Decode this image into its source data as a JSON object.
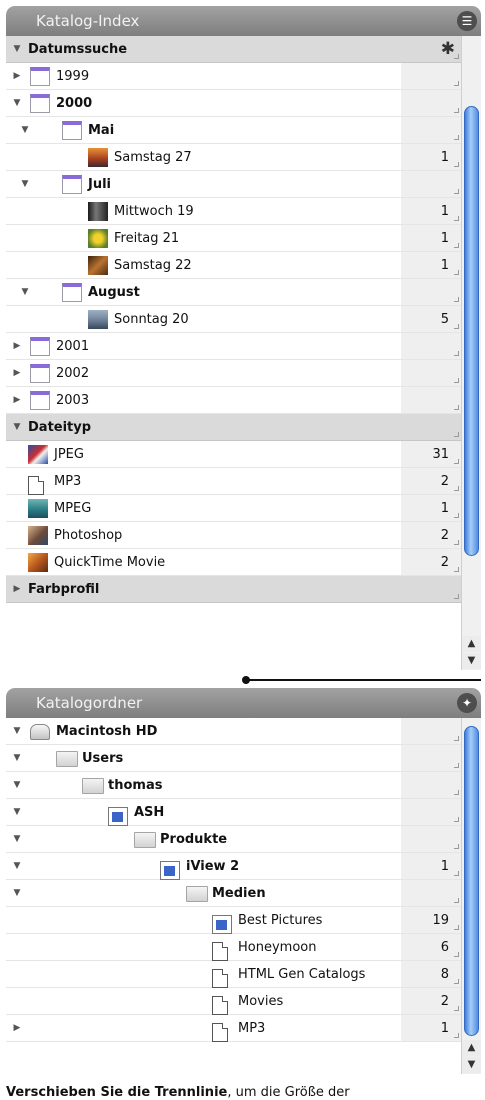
{
  "panel_top": {
    "title": "Katalog-Index",
    "title_button_icon": "list-icon",
    "rows": [
      {
        "kind": "header",
        "indent": 0,
        "expanded": true,
        "icon": "none",
        "label": "Datumssuche",
        "count": "",
        "gear": true
      },
      {
        "kind": "item",
        "indent": 0,
        "expanded": false,
        "icon": "calendar",
        "label": "1999",
        "count": ""
      },
      {
        "kind": "item",
        "indent": 0,
        "expanded": true,
        "icon": "calendar",
        "label": "2000",
        "count": "",
        "bold": true
      },
      {
        "kind": "item",
        "indent": 1,
        "expanded": true,
        "icon": "calendar",
        "label": "Mai",
        "count": "",
        "bold": true
      },
      {
        "kind": "item",
        "indent": 2,
        "icon": "thumb-sunset",
        "label": "Samstag 27",
        "count": "1"
      },
      {
        "kind": "item",
        "indent": 1,
        "expanded": true,
        "icon": "calendar",
        "label": "Juli",
        "count": "",
        "bold": true
      },
      {
        "kind": "item",
        "indent": 2,
        "icon": "thumb-dark",
        "label": "Mittwoch 19",
        "count": "1"
      },
      {
        "kind": "item",
        "indent": 2,
        "icon": "thumb-flower",
        "label": "Freitag 21",
        "count": "1"
      },
      {
        "kind": "item",
        "indent": 2,
        "icon": "thumb-brown",
        "label": "Samstag 22",
        "count": "1"
      },
      {
        "kind": "item",
        "indent": 1,
        "expanded": true,
        "icon": "calendar",
        "label": "August",
        "count": "",
        "bold": true
      },
      {
        "kind": "item",
        "indent": 2,
        "icon": "thumb-landscape",
        "label": "Sonntag 20",
        "count": "5"
      },
      {
        "kind": "item",
        "indent": 0,
        "expanded": false,
        "icon": "calendar",
        "label": "2001",
        "count": ""
      },
      {
        "kind": "item",
        "indent": 0,
        "expanded": false,
        "icon": "calendar",
        "label": "2002",
        "count": ""
      },
      {
        "kind": "item",
        "indent": 0,
        "expanded": false,
        "icon": "calendar",
        "label": "2003",
        "count": ""
      },
      {
        "kind": "header",
        "indent": 0,
        "expanded": true,
        "icon": "none",
        "label": "Dateityp",
        "count": ""
      },
      {
        "kind": "item",
        "indent": 0,
        "icon": "thumb-flag",
        "label": "JPEG",
        "count": "31"
      },
      {
        "kind": "item",
        "indent": 0,
        "icon": "doc",
        "label": "MP3",
        "count": "2"
      },
      {
        "kind": "item",
        "indent": 0,
        "icon": "thumb-sea",
        "label": "MPEG",
        "count": "1"
      },
      {
        "kind": "item",
        "indent": 0,
        "icon": "thumb-person",
        "label": "Photoshop",
        "count": "2"
      },
      {
        "kind": "item",
        "indent": 0,
        "icon": "thumb-orange",
        "label": "QuickTime Movie",
        "count": "2"
      },
      {
        "kind": "header",
        "indent": 0,
        "expanded": false,
        "icon": "none",
        "label": "Farbprofil",
        "count": ""
      }
    ]
  },
  "panel_bottom": {
    "title": "Katalogordner",
    "title_button_icon": "wand-icon",
    "rows": [
      {
        "kind": "item",
        "indent": 0,
        "expanded": true,
        "icon": "hd",
        "label": "Macintosh HD",
        "count": "",
        "bold": true
      },
      {
        "kind": "item",
        "indent": 1,
        "expanded": true,
        "icon": "folder",
        "label": "Users",
        "count": "",
        "bold": true
      },
      {
        "kind": "item",
        "indent": 2,
        "expanded": true,
        "icon": "folder",
        "label": "thomas",
        "count": "",
        "bold": true
      },
      {
        "kind": "item",
        "indent": 3,
        "expanded": true,
        "icon": "bfolder",
        "label": "ASH",
        "count": "",
        "bold": true
      },
      {
        "kind": "item",
        "indent": 4,
        "expanded": true,
        "icon": "folder",
        "label": "Produkte",
        "count": "",
        "bold": true
      },
      {
        "kind": "item",
        "indent": 5,
        "expanded": true,
        "icon": "bfolder",
        "label": "iView 2",
        "count": "1",
        "bold": true
      },
      {
        "kind": "item",
        "indent": 6,
        "expanded": true,
        "icon": "folder",
        "label": "Medien",
        "count": "",
        "bold": true
      },
      {
        "kind": "item",
        "indent": 7,
        "icon": "bfolder",
        "label": "Best Pictures",
        "count": "19"
      },
      {
        "kind": "item",
        "indent": 7,
        "icon": "doc",
        "label": "Honeymoon",
        "count": "6"
      },
      {
        "kind": "item",
        "indent": 7,
        "icon": "doc",
        "label": "HTML Gen Catalogs",
        "count": "8"
      },
      {
        "kind": "item",
        "indent": 7,
        "icon": "doc",
        "label": "Movies",
        "count": "2"
      },
      {
        "kind": "item",
        "indent": 7,
        "icon": "doc",
        "label": "MP3",
        "count": "1",
        "tri_left": true
      }
    ]
  },
  "caption": {
    "bold": "Verschieben Sie die Trennlinie",
    "rest": ", um die Größe der"
  },
  "colors": {
    "title_bar": "#8e8e8e",
    "header_row": "#dadada",
    "scroll_thumb": "#5a96e6",
    "calendar_top": "#8a6bd9"
  }
}
